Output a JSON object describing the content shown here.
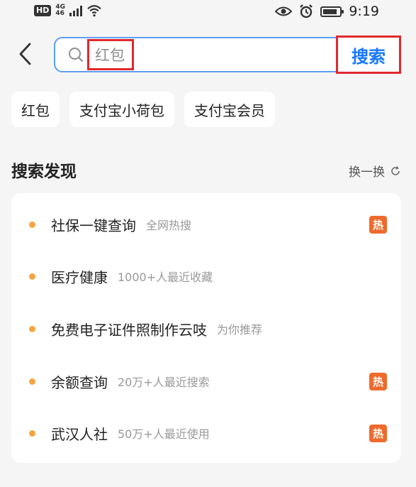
{
  "status_bar": {
    "hd": "HD",
    "network": "4G",
    "network_sub": "46",
    "time": "9:19",
    "battery_level": 0.85
  },
  "search": {
    "query": "红包",
    "button_label": "搜索"
  },
  "chips": [
    "红包",
    "支付宝小荷包",
    "支付宝会员"
  ],
  "discover": {
    "title": "搜索发现",
    "refresh_label": "换一换",
    "items": [
      {
        "title": "社保一键查询",
        "subtitle": "全网热搜",
        "hot": true
      },
      {
        "title": "医疗健康",
        "subtitle": "1000+人最近收藏",
        "hot": false
      },
      {
        "title": "免费电子证件照制作云吱",
        "subtitle": "为你推荐",
        "hot": false
      },
      {
        "title": "余额查询",
        "subtitle": "20万+人最近搜索",
        "hot": true
      },
      {
        "title": "武汉人社",
        "subtitle": "50万+人最近使用",
        "hot": true
      }
    ],
    "hot_label": "热"
  },
  "colors": {
    "accent": "#1677ff",
    "highlight_border": "#e0282e",
    "hot": "#ef6a2c",
    "dot": "#f5a443"
  }
}
